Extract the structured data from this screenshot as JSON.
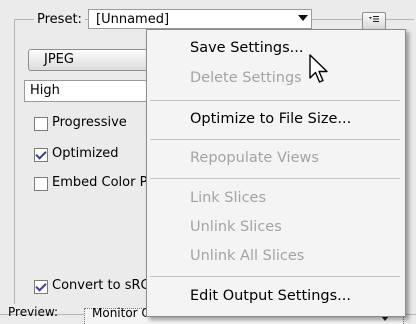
{
  "preset": {
    "label": "Preset:",
    "value": "[Unnamed]"
  },
  "format": {
    "value": "JPEG"
  },
  "quality": {
    "value": "High"
  },
  "options": [
    {
      "label": "Progressive",
      "checked": false
    },
    {
      "label": "Optimized",
      "checked": true
    },
    {
      "label": "Embed Color P",
      "checked": false
    },
    {
      "label": "Convert to sRG",
      "checked": true
    }
  ],
  "preview": {
    "label": "Preview:",
    "value": "Monitor Color"
  },
  "menu": {
    "items": [
      {
        "label": "Save Settings...",
        "enabled": true
      },
      {
        "label": "Delete Settings",
        "enabled": false
      },
      {
        "label": "Optimize to File Size...",
        "enabled": true
      },
      {
        "label": "Repopulate Views",
        "enabled": false
      },
      {
        "label": "Link Slices",
        "enabled": false
      },
      {
        "label": "Unlink Slices",
        "enabled": false
      },
      {
        "label": "Unlink All Slices",
        "enabled": false
      },
      {
        "label": "Edit Output Settings...",
        "enabled": true
      }
    ]
  },
  "colors": {
    "checkmark": "#3c3c9a",
    "disabled_text": "#a3a3a3",
    "menu_background": "#f4f4f4"
  }
}
